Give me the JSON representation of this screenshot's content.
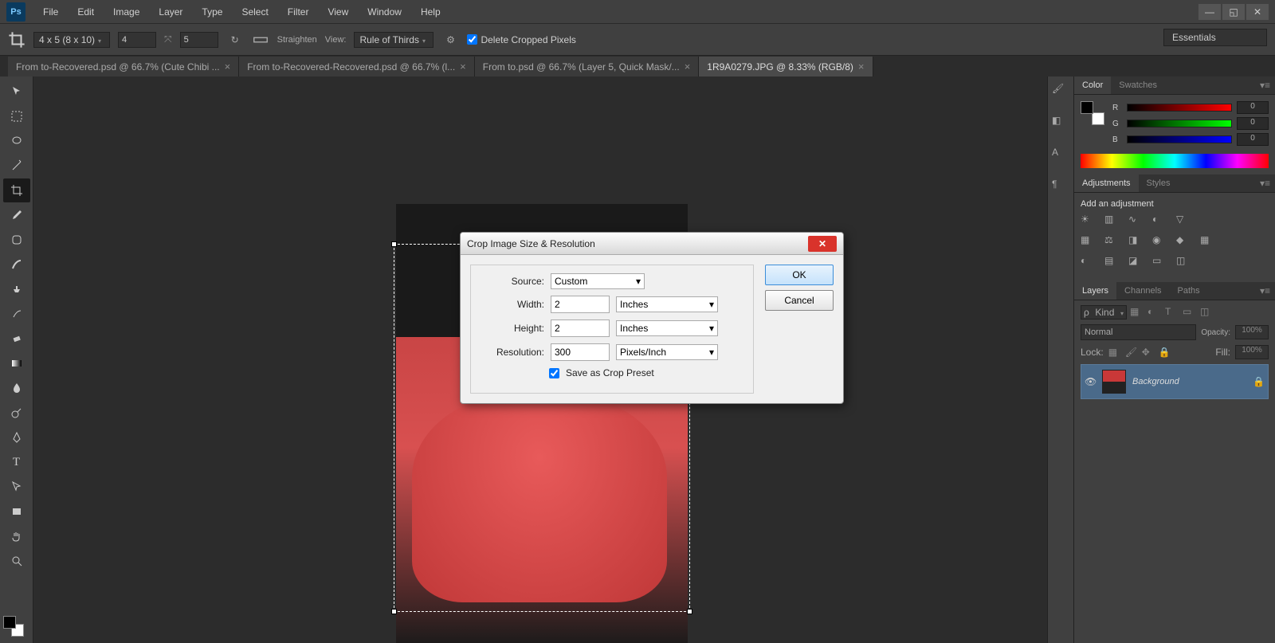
{
  "menubar": {
    "items": [
      "File",
      "Edit",
      "Image",
      "Layer",
      "Type",
      "Select",
      "Filter",
      "View",
      "Window",
      "Help"
    ]
  },
  "workspace": {
    "selected": "Essentials"
  },
  "options_bar": {
    "preset": "4 x 5 (8 x 10)",
    "input_a": "4",
    "input_b": "5",
    "straighten": "Straighten",
    "view_label": "View:",
    "overlay": "Rule of Thirds",
    "delete_cropped": "Delete Cropped Pixels"
  },
  "tabs": [
    {
      "label": "From to-Recovered.psd @ 66.7% (Cute Chibi ...",
      "active": false
    },
    {
      "label": "From to-Recovered-Recovered.psd @ 66.7% (l...",
      "active": false
    },
    {
      "label": "From to.psd @ 66.7% (Layer 5, Quick Mask/...",
      "active": false
    },
    {
      "label": "1R9A0279.JPG @ 8.33% (RGB/8)",
      "active": true
    }
  ],
  "dialog": {
    "title": "Crop Image Size & Resolution",
    "source_label": "Source:",
    "source_value": "Custom",
    "width_label": "Width:",
    "width_value": "2",
    "width_unit": "Inches",
    "height_label": "Height:",
    "height_value": "2",
    "height_unit": "Inches",
    "res_label": "Resolution:",
    "res_value": "300",
    "res_unit": "Pixels/Inch",
    "save_preset": "Save as Crop Preset",
    "ok": "OK",
    "cancel": "Cancel"
  },
  "panels": {
    "color_tab": "Color",
    "swatches_tab": "Swatches",
    "adjustments_tab": "Adjustments",
    "styles_tab": "Styles",
    "add_adjustment": "Add an adjustment",
    "layers_tab": "Layers",
    "channels_tab": "Channels",
    "paths_tab": "Paths",
    "kind": "Kind",
    "blend_mode": "Normal",
    "opacity_label": "Opacity:",
    "opacity_value": "100%",
    "lock_label": "Lock:",
    "fill_label": "Fill:",
    "fill_value": "100%",
    "layer_name": "Background",
    "r_label": "R",
    "g_label": "G",
    "b_label": "B",
    "r_val": "0",
    "g_val": "0",
    "b_val": "0"
  }
}
